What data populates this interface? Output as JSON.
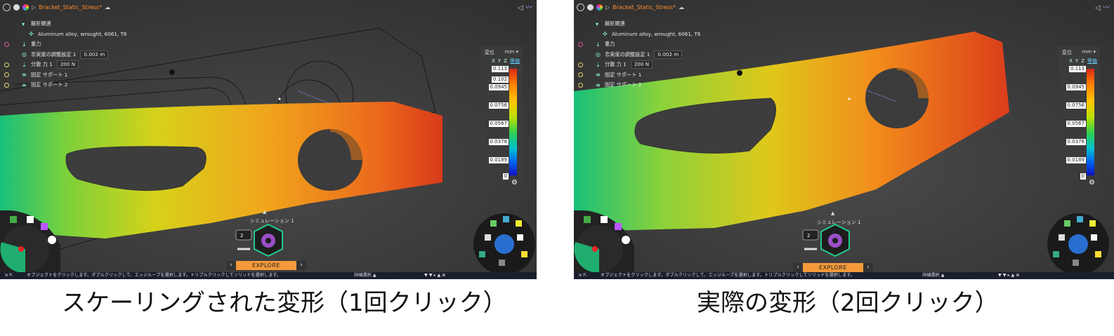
{
  "left_panel": {
    "document_title": "Bracket_Static_Stress*",
    "tree": {
      "root": "解析関連",
      "material": "Aluminum alloy, wrought, 6061, T6",
      "gravity": "重力",
      "refinement_label": "忠実度の調整設定 1",
      "refinement_value": "0.002 m",
      "force_label": "分散 力 1",
      "force_value": "200 N",
      "support1": "固定 サポート 1",
      "support2": "固定 サポート 2"
    },
    "legend": {
      "header": "変位",
      "unit": "mm",
      "axes": [
        "X",
        "Y",
        "Z",
        "等値"
      ],
      "ticks": [
        "0.113",
        "0.102",
        "0.0945",
        "0.0756",
        "0.0567",
        "0.0378",
        "0.0189",
        "0"
      ]
    },
    "wheel_label": "シミュレーション 1",
    "wheel_badge": "2",
    "explore_label": "EXPLORE",
    "status_message": "オブジェクトをクリックします。ダブルクリックして、エッジループを選択します。トリプルクリックしてソリッドを選択します。",
    "status_mid": "詳細選択"
  },
  "right_panel": {
    "document_title": "Bracket_Static_Stress*",
    "tree": {
      "root": "解析関連",
      "material": "Aluminum alloy, wrought, 6061, T6",
      "gravity": "重力",
      "refinement_label": "忠実度の調整設定 1",
      "refinement_value": "0.002 m",
      "force_label": "分散 力 1",
      "force_value": "200 N",
      "support1": "固定 サポート 1",
      "support2": "固定 サポート 2"
    },
    "legend": {
      "header": "変位",
      "unit": "mm",
      "axes": [
        "X",
        "Y",
        "Z",
        "等値"
      ],
      "ticks": [
        "0.113",
        "0.0945",
        "0.0756",
        "0.0567",
        "0.0378",
        "0.0189",
        "0"
      ]
    },
    "wheel_label": "シミュレーション 1",
    "wheel_badge": "2",
    "explore_label": "EXPLORE",
    "status_message": "オブジェクトをクリックします。ダブルクリックして、エッジループを選択します。トリプルクリックしてソリッドを選択します。",
    "status_mid": "詳細選択"
  },
  "captions": {
    "left": "スケーリングされた変形（1回クリック）",
    "right": "実際の変形（2回クリック）"
  },
  "colors": {
    "viewport_bg": "#3f3f3f",
    "accent_orange": "#f49a3a",
    "status_bg": "#1a1f2e"
  }
}
